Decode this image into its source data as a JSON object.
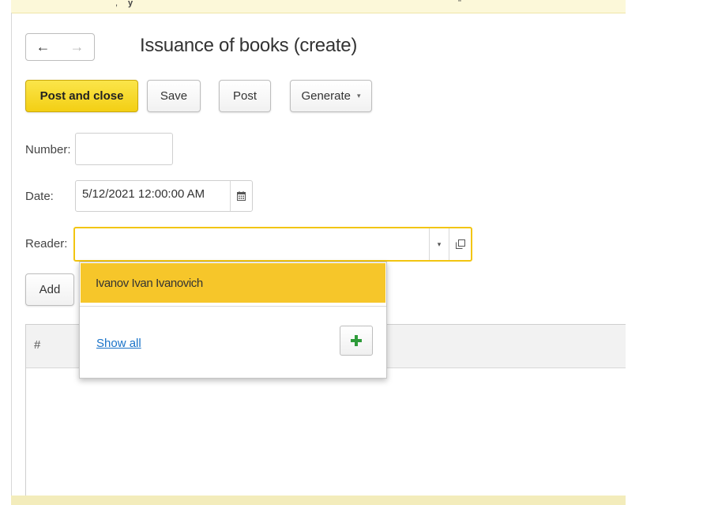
{
  "window": {
    "title": "Issuance of books (create)"
  },
  "nav": {
    "back_icon": "←",
    "forward_icon": "→"
  },
  "toolbar": {
    "post_and_close": "Post and close",
    "save": "Save",
    "post": "Post",
    "generate": "Generate",
    "generate_caret": "▾"
  },
  "form": {
    "number_label": "Number:",
    "number_value": "",
    "date_label": "Date:",
    "date_value": "5/12/2021 12:00:00 AM",
    "reader_label": "Reader:",
    "reader_value": "",
    "reader_dropdown_icon": "▾"
  },
  "table": {
    "add_label": "Add",
    "columns": [
      "#"
    ]
  },
  "dropdown": {
    "items": [
      "Ivanov Ivan Ivanovich"
    ],
    "show_all": "Show all",
    "create_icon": "plus-icon"
  },
  "colors": {
    "accent_yellow": "#f3cf14",
    "highlight": "#f6c62a",
    "focus_border": "#f2c511",
    "link": "#1a73c8",
    "plus_green": "#2e9b3a"
  }
}
